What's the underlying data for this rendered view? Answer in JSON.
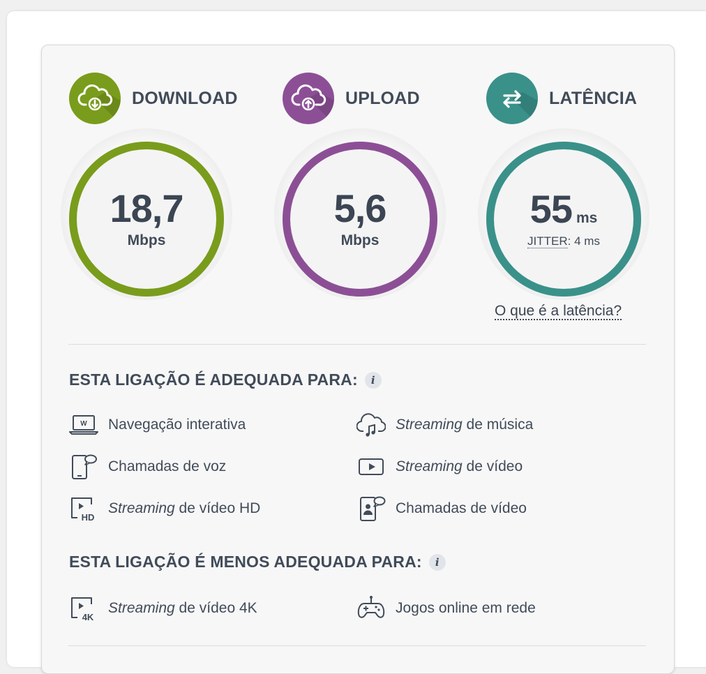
{
  "colors": {
    "download": "#7a9c1c",
    "upload": "#8c4f96",
    "latency": "#3a918a"
  },
  "download": {
    "title": "DOWNLOAD",
    "value": "18,7",
    "unit": "Mbps",
    "icon": "cloud-download-icon"
  },
  "upload": {
    "title": "UPLOAD",
    "value": "5,6",
    "unit": "Mbps",
    "icon": "cloud-upload-icon"
  },
  "latency": {
    "title": "LATÊNCIA",
    "value": "55",
    "unit": "ms",
    "jitter_label": "JITTER",
    "jitter_value": ": 4 ms",
    "link": "O que é a latência?",
    "icon": "arrows-exchange-icon"
  },
  "adequate": {
    "title": "ESTA LIGAÇÃO É ADEQUADA PARA:",
    "info": "i",
    "items": [
      {
        "em": "",
        "text": "Navegação interativa",
        "icon": "laptop-icon"
      },
      {
        "em": "Streaming",
        "text": " de música",
        "icon": "cloud-music-icon"
      },
      {
        "em": "",
        "text": "Chamadas de voz",
        "icon": "phone-call-icon"
      },
      {
        "em": "Streaming",
        "text": " de vídeo",
        "icon": "video-play-icon"
      },
      {
        "em": "Streaming",
        "text": " de vídeo HD",
        "icon": "video-hd-icon"
      },
      {
        "em": "",
        "text": "Chamadas de vídeo",
        "icon": "video-call-icon"
      }
    ]
  },
  "less_adequate": {
    "title": "ESTA LIGAÇÃO É MENOS ADEQUADA PARA:",
    "info": "i",
    "items": [
      {
        "em": "Streaming",
        "text": " de vídeo 4K",
        "icon": "video-4k-icon"
      },
      {
        "em": "",
        "text": "Jogos online em rede",
        "icon": "gamepad-icon"
      }
    ]
  }
}
